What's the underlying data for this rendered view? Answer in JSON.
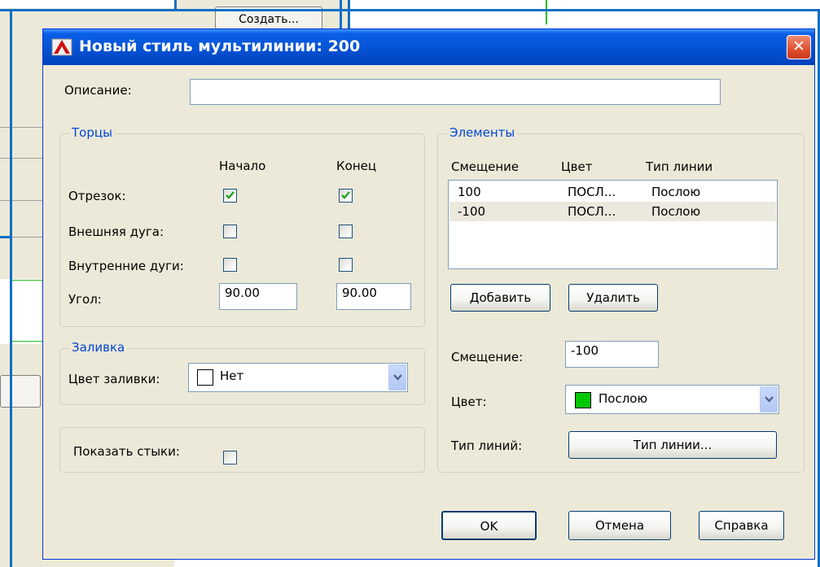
{
  "background": {
    "create_button": "Создать..."
  },
  "dialog": {
    "title": "Новый стиль мультилинии: 200",
    "close_symbol": "✕",
    "description_label": "Описание:",
    "description_value": "",
    "caps": {
      "group_title": "Торцы",
      "col_start": "Начало",
      "col_end": "Конец",
      "rows": [
        {
          "label": "Отрезок:",
          "start_checked": true,
          "end_checked": true
        },
        {
          "label": "Внешняя дуга:",
          "start_checked": false,
          "end_checked": false
        },
        {
          "label": "Внутренние дуги:",
          "start_checked": false,
          "end_checked": false
        }
      ],
      "angle_label": "Угол:",
      "angle_start": "90.00",
      "angle_end": "90.00"
    },
    "fill": {
      "group_title": "Заливка",
      "color_label": "Цвет заливки:",
      "color_value": "Нет",
      "swatch_color": "#ffffff"
    },
    "joints": {
      "label": "Показать стыки:",
      "checked": false
    },
    "elements": {
      "group_title": "Элементы",
      "headers": [
        "Смещение",
        "Цвет",
        "Тип линии"
      ],
      "rows": [
        {
          "offset": "100",
          "color": "ПОСЛ...",
          "linetype": "Послою",
          "selected": false
        },
        {
          "offset": "-100",
          "color": "ПОСЛ...",
          "linetype": "Послою",
          "selected": true
        }
      ],
      "add_button": "Добавить",
      "delete_button": "Удалить",
      "offset_label": "Смещение:",
      "offset_value": "-100",
      "color_label": "Цвет:",
      "color_value": "Послою",
      "color_swatch": "#00c800",
      "linetype_label": "Тип линий:",
      "linetype_button": "Тип линии..."
    },
    "buttons": {
      "ok": "OK",
      "cancel": "Отмена",
      "help": "Справка"
    }
  }
}
